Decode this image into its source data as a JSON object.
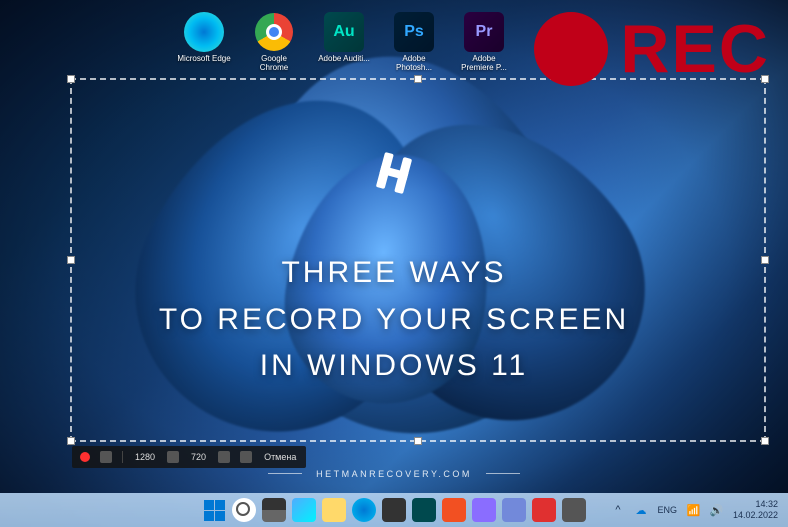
{
  "desktop": {
    "icons": [
      {
        "label": "Microsoft\nEdge"
      },
      {
        "label": "Google\nChrome"
      },
      {
        "label": "Adobe\nAuditi..."
      },
      {
        "label": "Adobe\nPhotosh..."
      },
      {
        "label": "Adobe\nPremiere P..."
      }
    ]
  },
  "rec": {
    "label": "REC"
  },
  "title": {
    "line1": "THREE WAYS",
    "line2": "TO RECORD YOUR SCREEN",
    "line3": "IN WINDOWS 11"
  },
  "recorder": {
    "width": "1280",
    "height": "720",
    "cancel": "Отмена"
  },
  "watermark": {
    "text": "HETMANRECOVERY.COM"
  },
  "systray": {
    "chevron": "^",
    "lang": "ENG",
    "time": "14:32",
    "date": "14.02.2022"
  },
  "adobe": {
    "au": "Au",
    "ps": "Ps",
    "pr": "Pr"
  }
}
